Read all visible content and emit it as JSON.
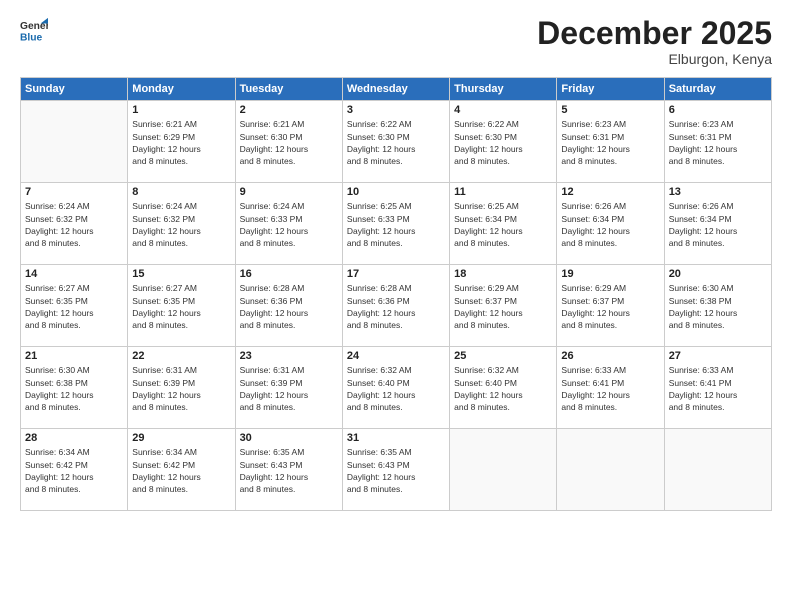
{
  "header": {
    "logo_general": "General",
    "logo_blue": "Blue",
    "title": "December 2025",
    "location": "Elburgon, Kenya"
  },
  "days_of_week": [
    "Sunday",
    "Monday",
    "Tuesday",
    "Wednesday",
    "Thursday",
    "Friday",
    "Saturday"
  ],
  "weeks": [
    [
      {
        "day": "",
        "detail": ""
      },
      {
        "day": "1",
        "detail": "Sunrise: 6:21 AM\nSunset: 6:29 PM\nDaylight: 12 hours\nand 8 minutes."
      },
      {
        "day": "2",
        "detail": "Sunrise: 6:21 AM\nSunset: 6:30 PM\nDaylight: 12 hours\nand 8 minutes."
      },
      {
        "day": "3",
        "detail": "Sunrise: 6:22 AM\nSunset: 6:30 PM\nDaylight: 12 hours\nand 8 minutes."
      },
      {
        "day": "4",
        "detail": "Sunrise: 6:22 AM\nSunset: 6:30 PM\nDaylight: 12 hours\nand 8 minutes."
      },
      {
        "day": "5",
        "detail": "Sunrise: 6:23 AM\nSunset: 6:31 PM\nDaylight: 12 hours\nand 8 minutes."
      },
      {
        "day": "6",
        "detail": "Sunrise: 6:23 AM\nSunset: 6:31 PM\nDaylight: 12 hours\nand 8 minutes."
      }
    ],
    [
      {
        "day": "7",
        "detail": "Sunrise: 6:24 AM\nSunset: 6:32 PM\nDaylight: 12 hours\nand 8 minutes."
      },
      {
        "day": "8",
        "detail": "Sunrise: 6:24 AM\nSunset: 6:32 PM\nDaylight: 12 hours\nand 8 minutes."
      },
      {
        "day": "9",
        "detail": "Sunrise: 6:24 AM\nSunset: 6:33 PM\nDaylight: 12 hours\nand 8 minutes."
      },
      {
        "day": "10",
        "detail": "Sunrise: 6:25 AM\nSunset: 6:33 PM\nDaylight: 12 hours\nand 8 minutes."
      },
      {
        "day": "11",
        "detail": "Sunrise: 6:25 AM\nSunset: 6:34 PM\nDaylight: 12 hours\nand 8 minutes."
      },
      {
        "day": "12",
        "detail": "Sunrise: 6:26 AM\nSunset: 6:34 PM\nDaylight: 12 hours\nand 8 minutes."
      },
      {
        "day": "13",
        "detail": "Sunrise: 6:26 AM\nSunset: 6:34 PM\nDaylight: 12 hours\nand 8 minutes."
      }
    ],
    [
      {
        "day": "14",
        "detail": "Sunrise: 6:27 AM\nSunset: 6:35 PM\nDaylight: 12 hours\nand 8 minutes."
      },
      {
        "day": "15",
        "detail": "Sunrise: 6:27 AM\nSunset: 6:35 PM\nDaylight: 12 hours\nand 8 minutes."
      },
      {
        "day": "16",
        "detail": "Sunrise: 6:28 AM\nSunset: 6:36 PM\nDaylight: 12 hours\nand 8 minutes."
      },
      {
        "day": "17",
        "detail": "Sunrise: 6:28 AM\nSunset: 6:36 PM\nDaylight: 12 hours\nand 8 minutes."
      },
      {
        "day": "18",
        "detail": "Sunrise: 6:29 AM\nSunset: 6:37 PM\nDaylight: 12 hours\nand 8 minutes."
      },
      {
        "day": "19",
        "detail": "Sunrise: 6:29 AM\nSunset: 6:37 PM\nDaylight: 12 hours\nand 8 minutes."
      },
      {
        "day": "20",
        "detail": "Sunrise: 6:30 AM\nSunset: 6:38 PM\nDaylight: 12 hours\nand 8 minutes."
      }
    ],
    [
      {
        "day": "21",
        "detail": "Sunrise: 6:30 AM\nSunset: 6:38 PM\nDaylight: 12 hours\nand 8 minutes."
      },
      {
        "day": "22",
        "detail": "Sunrise: 6:31 AM\nSunset: 6:39 PM\nDaylight: 12 hours\nand 8 minutes."
      },
      {
        "day": "23",
        "detail": "Sunrise: 6:31 AM\nSunset: 6:39 PM\nDaylight: 12 hours\nand 8 minutes."
      },
      {
        "day": "24",
        "detail": "Sunrise: 6:32 AM\nSunset: 6:40 PM\nDaylight: 12 hours\nand 8 minutes."
      },
      {
        "day": "25",
        "detail": "Sunrise: 6:32 AM\nSunset: 6:40 PM\nDaylight: 12 hours\nand 8 minutes."
      },
      {
        "day": "26",
        "detail": "Sunrise: 6:33 AM\nSunset: 6:41 PM\nDaylight: 12 hours\nand 8 minutes."
      },
      {
        "day": "27",
        "detail": "Sunrise: 6:33 AM\nSunset: 6:41 PM\nDaylight: 12 hours\nand 8 minutes."
      }
    ],
    [
      {
        "day": "28",
        "detail": "Sunrise: 6:34 AM\nSunset: 6:42 PM\nDaylight: 12 hours\nand 8 minutes."
      },
      {
        "day": "29",
        "detail": "Sunrise: 6:34 AM\nSunset: 6:42 PM\nDaylight: 12 hours\nand 8 minutes."
      },
      {
        "day": "30",
        "detail": "Sunrise: 6:35 AM\nSunset: 6:43 PM\nDaylight: 12 hours\nand 8 minutes."
      },
      {
        "day": "31",
        "detail": "Sunrise: 6:35 AM\nSunset: 6:43 PM\nDaylight: 12 hours\nand 8 minutes."
      },
      {
        "day": "",
        "detail": ""
      },
      {
        "day": "",
        "detail": ""
      },
      {
        "day": "",
        "detail": ""
      }
    ]
  ]
}
